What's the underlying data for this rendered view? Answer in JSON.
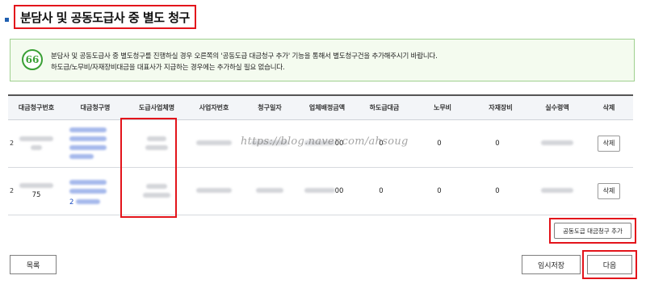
{
  "page": {
    "title": "분담사 및 공동도급사 중 별도 청구"
  },
  "notice": {
    "icon": "quote-icon",
    "icon_glyph": "66",
    "line1": "분담사 및 공동도급사 중 별도청구를 진행하실 경우 오른쪽의 '공동도급 대금청구 추가' 기능을 통해서 별도청구건을 추가해주시기 바랍니다.",
    "line2": "하도급/노무비/자재장비대금을 대표사가 지급하는 경우에는 추가하실 필요 없습니다."
  },
  "table": {
    "headers": [
      "대금청구번호",
      "대금청구명",
      "도급사업체명",
      "사업자번호",
      "청구일자",
      "업체배정금액",
      "하도급대금",
      "노무비",
      "자재장비",
      "실수령액",
      "삭제"
    ],
    "rows": [
      {
        "no_visible": "2",
        "amount_suffix": "00",
        "subcontract": "0",
        "labor": "0",
        "material": "0",
        "delete_label": "삭제"
      },
      {
        "no_visible": "2",
        "no_line2": "75",
        "link_prefix": "2",
        "amount_suffix": "00",
        "subcontract": "0",
        "labor": "0",
        "material": "0",
        "delete_label": "삭제"
      }
    ]
  },
  "watermark": "https://blog.naver.com/ahsoug",
  "buttons": {
    "add_joint_claim": "공동도급 대금청구 추가",
    "list": "목록",
    "temp_save": "임시저장",
    "next": "다음"
  },
  "colors": {
    "highlight": "#e3141b",
    "notice_border": "#9fd08f",
    "accent": "#1f5fb0"
  }
}
